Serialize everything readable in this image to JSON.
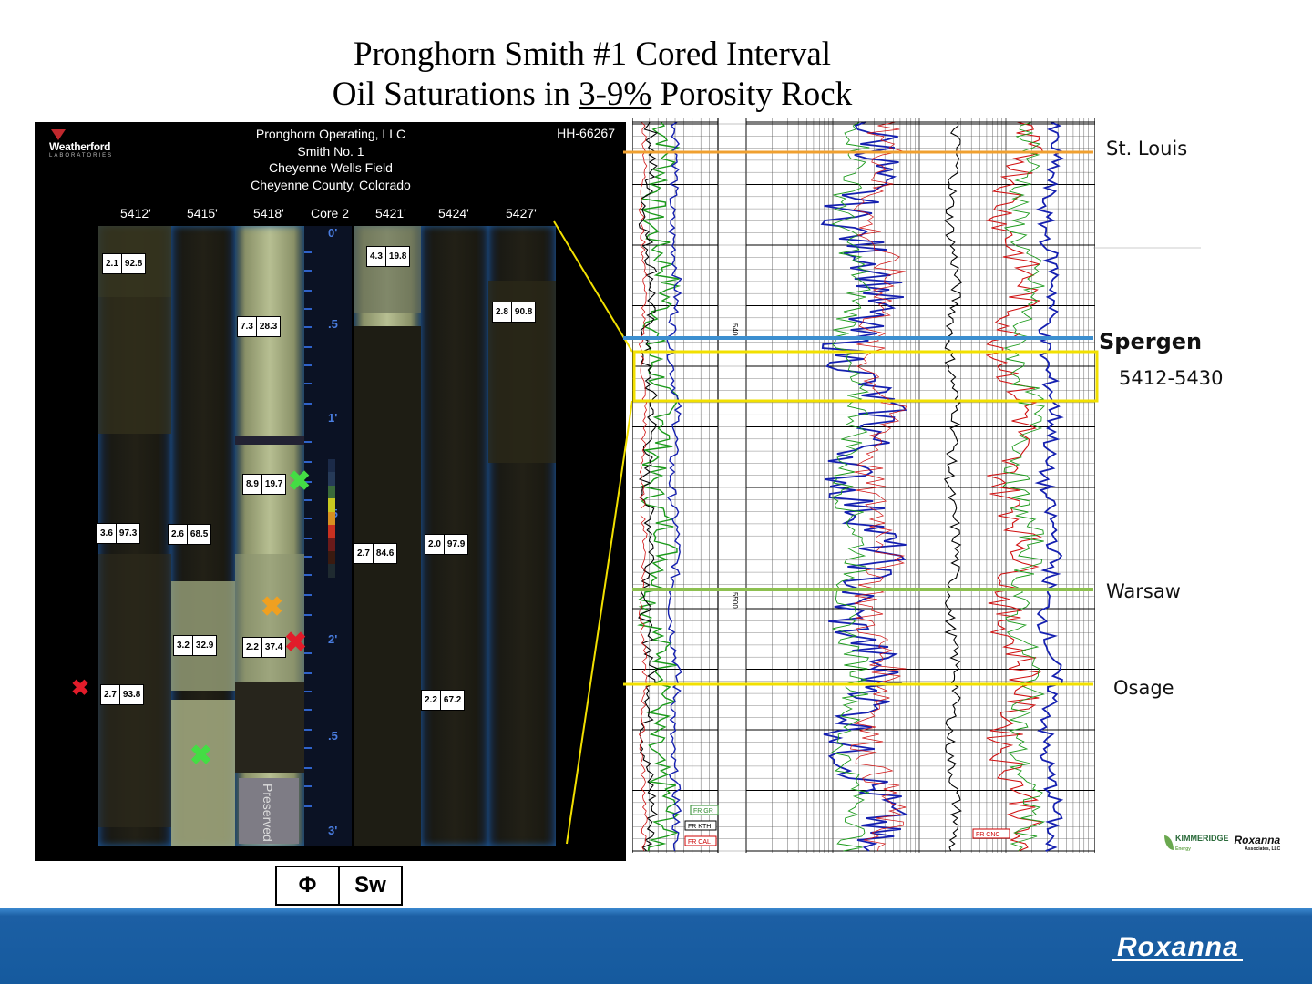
{
  "title": {
    "line1": "Pronghorn Smith #1 Cored Interval",
    "line2_pre": "Oil Saturations in ",
    "line2_underlined": "3-9%",
    "line2_post": " Porosity Rock"
  },
  "core_photo": {
    "lab_name": "Weatherford",
    "lab_sub": "LABORATORIES",
    "header": {
      "operator": "Pronghorn Operating, LLC",
      "well": "Smith No. 1",
      "field": "Cheyenne Wells Field",
      "county": "Cheyenne County, Colorado"
    },
    "sample_id": "HH-66267",
    "column_labels": [
      "5412'",
      "5415'",
      "5418'",
      "Core 2",
      "5421'",
      "5424'",
      "5427'"
    ],
    "scale_labels": [
      "0'",
      ".5",
      "1'",
      ".5",
      "2'",
      ".5",
      "3'"
    ],
    "preserved_label": "Preserved",
    "measurements": [
      {
        "phi": "2.1",
        "sw": "92.8"
      },
      {
        "phi": "4.3",
        "sw": "19.8"
      },
      {
        "phi": "2.8",
        "sw": "90.8"
      },
      {
        "phi": "7.3",
        "sw": "28.3"
      },
      {
        "phi": "8.9",
        "sw": "19.7"
      },
      {
        "phi": "3.6",
        "sw": "97.3"
      },
      {
        "phi": "2.6",
        "sw": "68.5"
      },
      {
        "phi": "2.7",
        "sw": "84.6"
      },
      {
        "phi": "2.0",
        "sw": "97.9"
      },
      {
        "phi": "3.2",
        "sw": "32.9"
      },
      {
        "phi": "2.2",
        "sw": "37.4"
      },
      {
        "phi": "2.7",
        "sw": "93.8"
      },
      {
        "phi": "2.2",
        "sw": "67.2"
      }
    ],
    "marker_colors": {
      "green": "#44dd44",
      "orange": "#f0a020",
      "red": "#e21c2a"
    }
  },
  "legend": {
    "phi": "Φ",
    "sw": "Sw"
  },
  "well_log": {
    "depth_labels": [
      "5400",
      "5500"
    ],
    "curve_tags": [
      "FR GR",
      "FR KTH",
      "FR CAL",
      "FR CNC"
    ],
    "zone": {
      "name": "Spergen",
      "interval": "5412-5430"
    }
  },
  "formations": {
    "st_louis": "St. Louis",
    "spergen": "Spergen",
    "interval": "5412-5430",
    "warsaw": "Warsaw",
    "osage": "Osage"
  },
  "logos": {
    "kimmeridge": "KIMMERIDGE",
    "kimmeridge_sub": "Energy",
    "roxanna_small": "Roxanna",
    "roxanna_sub": "Associates, LLC",
    "footer": "Roxanna"
  },
  "colors": {
    "footer_blue": "#155a9e",
    "st_louis_line": "#f0a030",
    "spergen_line": "#3c8fd0",
    "warsaw_line": "#8dc050",
    "osage_line": "#f2e000",
    "zone_box": "#f2e000"
  }
}
